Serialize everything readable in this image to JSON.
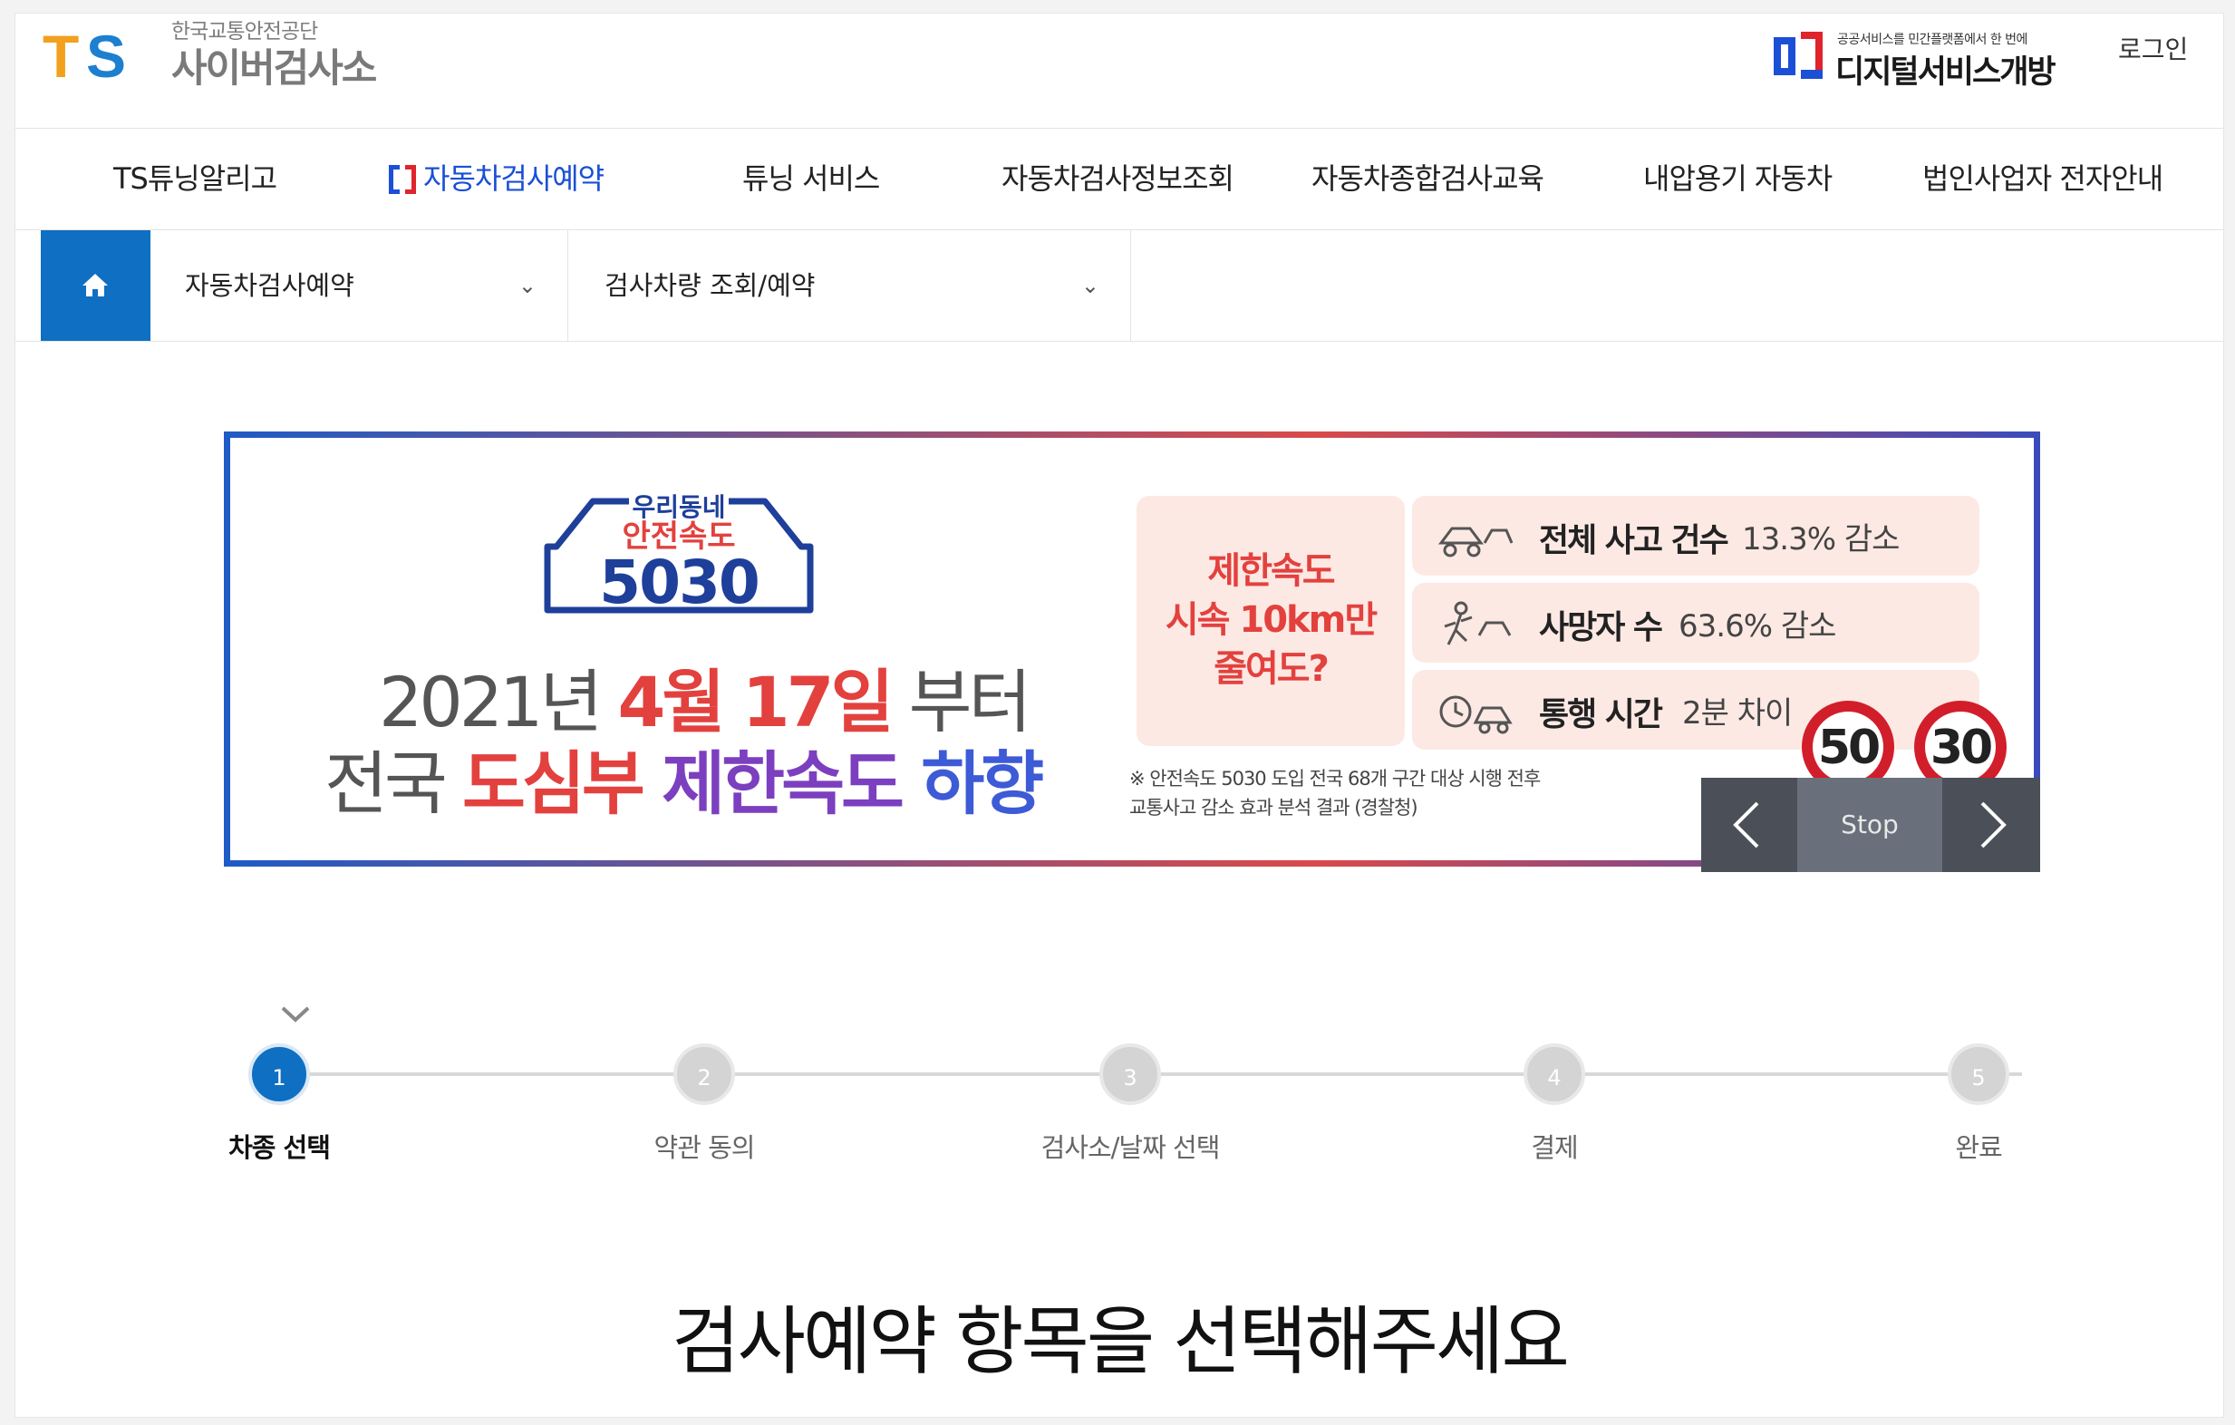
{
  "header": {
    "logo_text": "TS",
    "org_name": "한국교통안전공단",
    "site_name": "사이버검사소",
    "ds_tagline": "공공서비스를 민간플랫폼에서 한 번에",
    "ds_name": "디지털서비스개방",
    "login_label": "로그인"
  },
  "nav": {
    "items": [
      {
        "label": "TS튜닝알리고"
      },
      {
        "label": "자동차검사예약"
      },
      {
        "label": "튜닝 서비스"
      },
      {
        "label": "자동차검사정보조회"
      },
      {
        "label": "자동차종합검사교육"
      },
      {
        "label": "내압용기 자동차"
      },
      {
        "label": "법인사업자 전자안내"
      }
    ],
    "active_index": 1
  },
  "breadcrumb": {
    "home_icon": "home-icon",
    "level1": "자동차검사예약",
    "level2": "검사차량 조회/예약"
  },
  "banner": {
    "logo_top": "우리동네",
    "logo_mid": "안전속도",
    "logo_num": "5030",
    "line1_pre": "2021년 ",
    "line1_date": "4월 17일",
    "line1_post": " 부터",
    "line2_pre": "전국 ",
    "line2_a": "도심부",
    "line2_b": " 제한속도",
    "line2_c": " 하향",
    "question_1": "제한속도",
    "question_2": "시속 10km만",
    "question_3": "줄여도?",
    "stats": [
      {
        "label": "전체 사고 건수",
        "value": "13.3% 감소"
      },
      {
        "label": "사망자 수",
        "value": "63.6% 감소"
      },
      {
        "label": "통행 시간",
        "value": "2분 차이"
      }
    ],
    "note_1": "※ 안전속도 5030 도입 전국 68개 구간 대상 시행 전후",
    "note_2": "교통사고 감소 효과 분석 결과 (경찰청)",
    "sign_1": "50",
    "sign_2": "30",
    "controls": {
      "prev_icon": "chevron-left-icon",
      "stop_label": "Stop",
      "next_icon": "chevron-right-icon"
    }
  },
  "steps": {
    "items": [
      {
        "num": "1",
        "label": "차종 선택"
      },
      {
        "num": "2",
        "label": "약관 동의"
      },
      {
        "num": "3",
        "label": "검사소/날짜 선택"
      },
      {
        "num": "4",
        "label": "결제"
      },
      {
        "num": "5",
        "label": "완료"
      }
    ],
    "current": 1
  },
  "headline": "검사예약 항목을 선택해주세요",
  "colors": {
    "primary": "#0f6fc2",
    "nav_active": "#1a4fd6",
    "banner_red": "#e3413e"
  }
}
